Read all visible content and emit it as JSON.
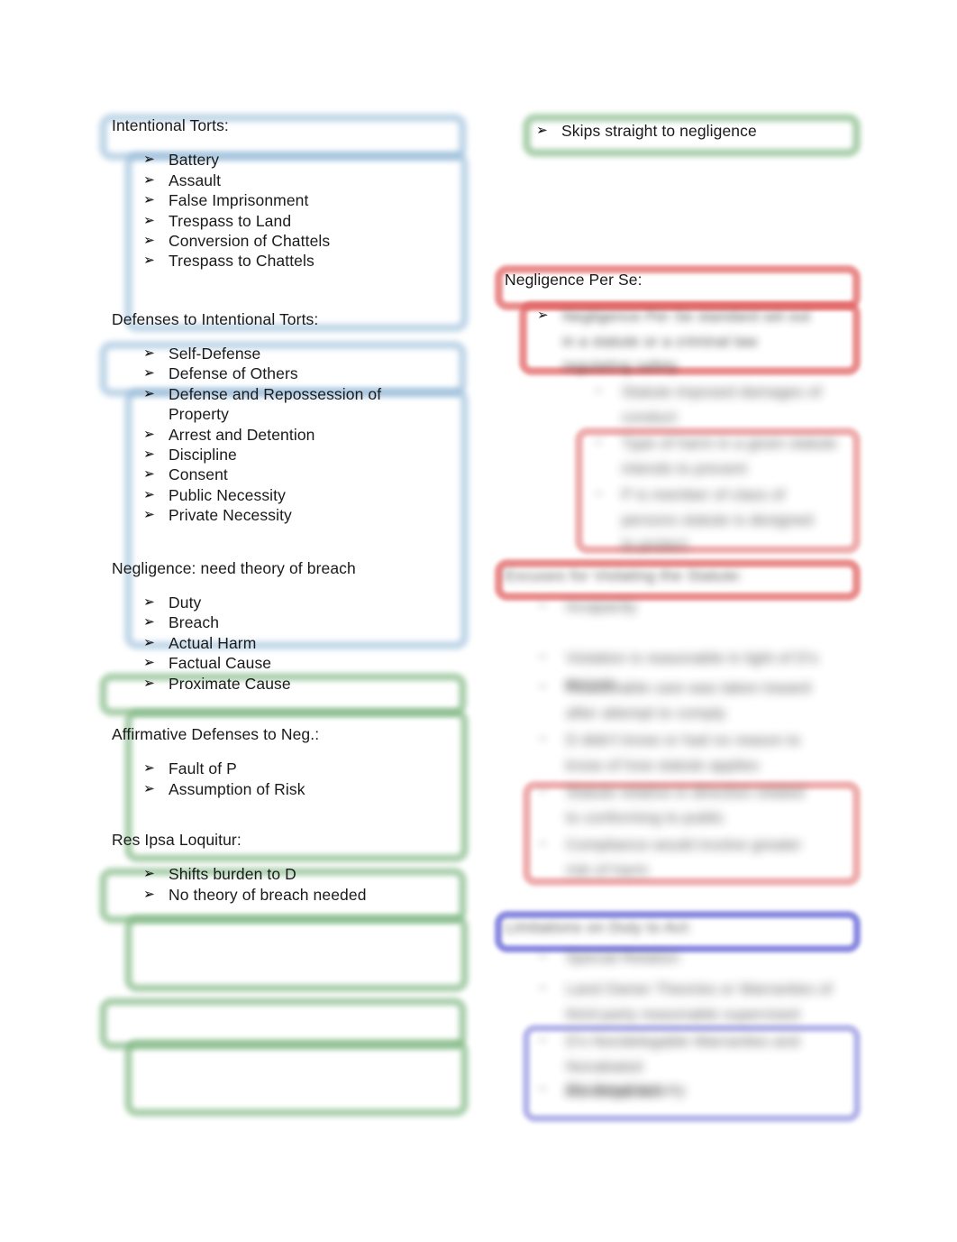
{
  "document": {
    "type": "outline-notes",
    "background_color": "#ffffff",
    "title_not_shown": true
  },
  "palette": {
    "highlight_blue": "#8db5d6",
    "highlight_green": "#7bb57e",
    "highlight_red": "#e26060",
    "highlight_red_soft": "#e88c8c",
    "highlight_indigo": "#5c5cd6",
    "highlight_indigo_soft": "#9696e1",
    "text": "#1a1a1a"
  },
  "icons": {
    "bullet": "➢",
    "bullet_name": "arrow-bullet-icon"
  },
  "left_column": {
    "sections": [
      {
        "id": "intentional-torts",
        "heading": "Intentional Torts:",
        "highlight": "blue",
        "items": [
          "Battery",
          "Assault",
          "False Imprisonment",
          "Trespass to Land",
          "Conversion of Chattels",
          "Trespass to Chattels"
        ]
      },
      {
        "id": "defenses-to-intentional-torts",
        "heading": "Defenses to Intentional Torts:",
        "highlight": "blue",
        "items": [
          "Self-Defense",
          "Defense of Others",
          "Defense and Repossession of Property",
          "Arrest and Detention",
          "Discipline",
          "Consent",
          "Public Necessity",
          "Private Necessity"
        ]
      },
      {
        "id": "negligence",
        "heading": "Negligence: need theory of breach",
        "highlight": "green",
        "items": [
          "Duty",
          "Breach",
          "Actual Harm",
          "Factual Cause",
          "Proximate Cause"
        ]
      },
      {
        "id": "affirmative-defenses-to-negligence",
        "heading": "Affirmative Defenses to Neg.:",
        "highlight": "green",
        "items": [
          "Fault of P",
          "Assumption of Risk"
        ]
      },
      {
        "id": "res-ipsa-loquitur",
        "heading": "Res Ipsa Loquitur:",
        "highlight": "green",
        "items": [
          "Shifts burden to D",
          "No theory of breach needed"
        ]
      }
    ]
  },
  "right_column": {
    "top_note": {
      "id": "skips-straight-to-negligence",
      "highlight": "green",
      "text": "Skips straight to negligence"
    },
    "sections": [
      {
        "id": "negligence-per-se",
        "heading": "Negligence Per Se:",
        "highlight": "red",
        "content_state": "blurred",
        "content_note": "text is blurred and illegible in the screenshot"
      },
      {
        "id": "red-block-two",
        "heading": "",
        "highlight": "red",
        "content_state": "blurred",
        "content_note": "heading bar and list items blurred and illegible"
      },
      {
        "id": "indigo-block",
        "heading": "",
        "highlight": "indigo",
        "content_state": "blurred",
        "content_note": "heading bar and list items blurred and illegible"
      }
    ]
  }
}
